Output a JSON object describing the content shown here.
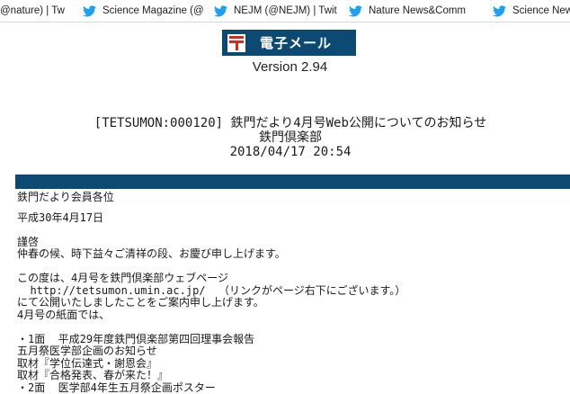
{
  "bookmarks": [
    {
      "label": "@nature) | Tw",
      "icon": "twitter-bird-icon"
    },
    {
      "label": "Science Magazine (@",
      "icon": "twitter-bird-icon"
    },
    {
      "label": "NEJM (@NEJM) | Twit",
      "icon": "twitter-bird-icon"
    },
    {
      "label": "Nature News&Comm",
      "icon": "twitter-bird-icon"
    },
    {
      "label": "Science News",
      "icon": "twitter-bird-icon"
    }
  ],
  "colors": {
    "brand": "#0d4a73",
    "twitter": "#1da1f2",
    "logo_mark": "#d42a1e"
  },
  "app": {
    "logo_text": "電子メール",
    "version": "Version 2.94"
  },
  "message": {
    "subject": "[TETSUMON:000120] 鉄門だより4月号Web公開についてのお知らせ",
    "sender": "鉄門倶楽部",
    "date": "2018/04/17 20:54",
    "body": {
      "greeting": "鉄門だより会員各位",
      "date_line": "平成30年4月17日",
      "salutation": "謹啓",
      "seasonal": "仲春の候、時下益々ご清祥の段、お慶び申し上げます。",
      "notice_1": "この度は、4月号を鉄門倶楽部ウェブページ",
      "url_line": "  http://tetsumon.umin.ac.jp/  （リンクがページ右下にございます。）",
      "notice_2": "にて公開いたしましたことをご案内申し上げます。",
      "notice_3": "4月号の紙面では、",
      "item_1": "・1面  平成29年度鉄門倶楽部第四回理事会報告",
      "item_2": "五月祭医学部企画のお知らせ",
      "item_3": "取材『学位伝達式・謝恩会』",
      "item_4": "取材『合格発表、春が来た！』",
      "item_5": "・2面  医学部4年生五月祭企画ポスター"
    }
  }
}
